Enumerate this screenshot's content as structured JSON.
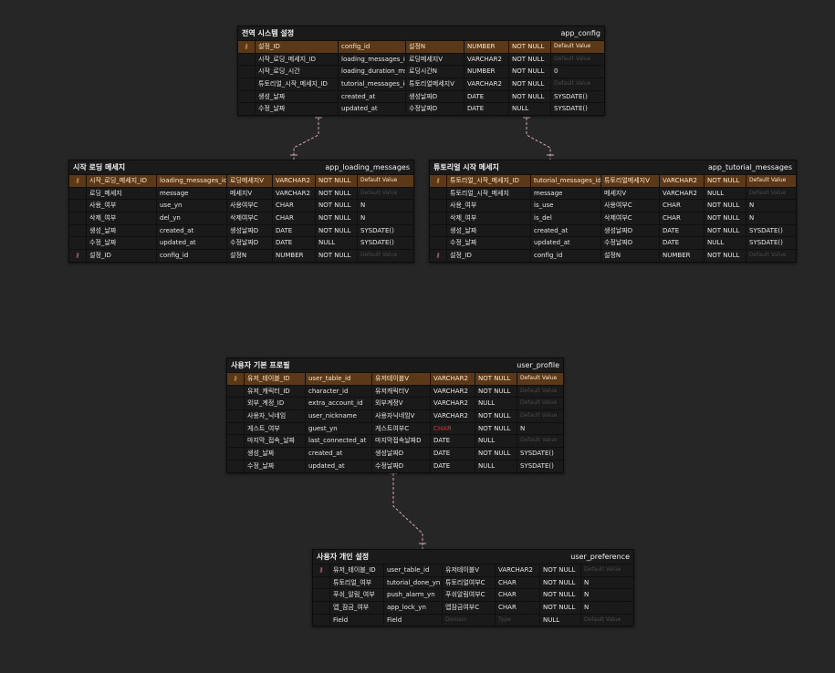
{
  "entities": {
    "app_config": {
      "logical": "전역 시스템 설정",
      "physical": "app_config",
      "rows": [
        {
          "key": "pk",
          "c": [
            "설정_ID",
            "config_id",
            "설정N",
            "NUMBER",
            "NOT NULL",
            "Default Value"
          ],
          "dim": [
            5
          ]
        },
        {
          "key": "",
          "c": [
            "시작_로딩_메세지_ID",
            "loading_messages_id",
            "로딩메세지V",
            "VARCHAR2",
            "NOT NULL",
            "Default Value"
          ],
          "dim": [
            5
          ]
        },
        {
          "key": "",
          "c": [
            "시작_로딩_시간",
            "loading_duration_ms",
            "로딩시간N",
            "NUMBER",
            "NOT NULL",
            "0"
          ],
          "dim": []
        },
        {
          "key": "",
          "c": [
            "튜토리얼_시작_메세지_ID",
            "tutorial_messages_id",
            "튜토리얼메세지V",
            "VARCHAR2",
            "NOT NULL",
            "Default Value"
          ],
          "dim": [
            5
          ]
        },
        {
          "key": "",
          "c": [
            "생성_날짜",
            "created_at",
            "생성날짜D",
            "DATE",
            "NOT NULL",
            "SYSDATE()"
          ],
          "dim": []
        },
        {
          "key": "",
          "c": [
            "수정_날짜",
            "updated_at",
            "수정날짜D",
            "DATE",
            "NULL",
            "SYSDATE()"
          ],
          "dim": []
        }
      ]
    },
    "app_loading_messages": {
      "logical": "시작 로딩 메세지",
      "physical": "app_loading_messages",
      "rows": [
        {
          "key": "pk",
          "c": [
            "시작_로딩_메세지_ID",
            "loading_messages_id",
            "로딩메세지V",
            "VARCHAR2",
            "NOT NULL",
            "Default Value"
          ],
          "dim": [
            5
          ]
        },
        {
          "key": "",
          "c": [
            "로딩_메세지",
            "message",
            "메세지V",
            "VARCHAR2",
            "NOT NULL",
            "Default Value"
          ],
          "dim": [
            5
          ]
        },
        {
          "key": "",
          "c": [
            "사용_여부",
            "use_yn",
            "사용여부C",
            "CHAR",
            "NOT NULL",
            "N"
          ],
          "dim": []
        },
        {
          "key": "",
          "c": [
            "삭제_여부",
            "del_yn",
            "삭제여부C",
            "CHAR",
            "NOT NULL",
            "N"
          ],
          "dim": []
        },
        {
          "key": "",
          "c": [
            "생성_날짜",
            "created_at",
            "생성날짜D",
            "DATE",
            "NOT NULL",
            "SYSDATE()"
          ],
          "dim": []
        },
        {
          "key": "",
          "c": [
            "수정_날짜",
            "updated_at",
            "수정날짜D",
            "DATE",
            "NULL",
            "SYSDATE()"
          ],
          "dim": []
        },
        {
          "key": "fk",
          "c": [
            "설정_ID",
            "config_id",
            "설정N",
            "NUMBER",
            "NOT NULL",
            "Default Value"
          ],
          "dim": [
            5
          ]
        }
      ]
    },
    "app_tutorial_messages": {
      "logical": "튜토리얼 시작 메세지",
      "physical": "app_tutorial_messages",
      "rows": [
        {
          "key": "pk",
          "c": [
            "튜토리얼_시작_메세지_ID",
            "tutorial_messages_id",
            "튜토리얼메세지V",
            "VARCHAR2",
            "NOT NULL",
            "Default Value"
          ],
          "dim": [
            5
          ]
        },
        {
          "key": "",
          "c": [
            "튜토리얼_시작_메세지",
            "message",
            "메세지V",
            "VARCHAR2",
            "NULL",
            "Default Value"
          ],
          "dim": [
            5
          ]
        },
        {
          "key": "",
          "c": [
            "사용_여부",
            "is_use",
            "사용여부C",
            "CHAR",
            "NOT NULL",
            "N"
          ],
          "dim": []
        },
        {
          "key": "",
          "c": [
            "삭제_여부",
            "is_del",
            "삭제여부C",
            "CHAR",
            "NOT NULL",
            "N"
          ],
          "dim": []
        },
        {
          "key": "",
          "c": [
            "생성_날짜",
            "created_at",
            "생성날짜D",
            "DATE",
            "NOT NULL",
            "SYSDATE()"
          ],
          "dim": []
        },
        {
          "key": "",
          "c": [
            "수정_날짜",
            "updated_at",
            "수정날짜D",
            "DATE",
            "NULL",
            "SYSDATE()"
          ],
          "dim": []
        },
        {
          "key": "fk",
          "c": [
            "설정_ID",
            "config_id",
            "설정N",
            "NUMBER",
            "NOT NULL",
            "Default Value"
          ],
          "dim": [
            5
          ]
        }
      ]
    },
    "user_profile": {
      "logical": "사용자 기본 프로필",
      "physical": "user_profile",
      "rows": [
        {
          "key": "pk",
          "c": [
            "유저_테이블_ID",
            "user_table_id",
            "유저테이블V",
            "VARCHAR2",
            "NOT NULL",
            "Default Value"
          ],
          "dim": [
            5
          ]
        },
        {
          "key": "",
          "c": [
            "유저_캐릭터_ID",
            "character_id",
            "유저캐릭터V",
            "VARCHAR2",
            "NOT NULL",
            "Default Value"
          ],
          "dim": [
            5
          ]
        },
        {
          "key": "",
          "c": [
            "외부_계정_ID",
            "extra_account_id",
            "외부계정V",
            "VARCHAR2",
            "NULL",
            "Default Value"
          ],
          "dim": [
            5
          ]
        },
        {
          "key": "",
          "c": [
            "사용자_닉네임",
            "user_nickname",
            "사용자닉네임V",
            "VARCHAR2",
            "NOT NULL",
            "Default Value"
          ],
          "dim": [
            5
          ]
        },
        {
          "key": "",
          "c": [
            "게스트_여부",
            "guest_yn",
            "게스트여부C",
            "CHAR",
            "NOT NULL",
            "N"
          ],
          "dim": [],
          "red": [
            3
          ]
        },
        {
          "key": "",
          "c": [
            "마지막_접속_날짜",
            "last_connected_at",
            "마지막접속날짜D",
            "DATE",
            "NULL",
            "Default Value"
          ],
          "dim": [
            5
          ]
        },
        {
          "key": "",
          "c": [
            "생성_날짜",
            "created_at",
            "생성날짜D",
            "DATE",
            "NOT NULL",
            "SYSDATE()"
          ],
          "dim": []
        },
        {
          "key": "",
          "c": [
            "수정_날짜",
            "updated_at",
            "수정날짜D",
            "DATE",
            "NULL",
            "SYSDATE()"
          ],
          "dim": []
        }
      ]
    },
    "user_preference": {
      "logical": "사용자 개인 설정",
      "physical": "user_preference",
      "rows": [
        {
          "key": "fk",
          "c": [
            "유저_테이블_ID",
            "user_table_id",
            "유저테이블V",
            "VARCHAR2",
            "NOT NULL",
            "Default Value"
          ],
          "dim": [
            5
          ]
        },
        {
          "key": "",
          "c": [
            "튜토리얼_여부",
            "tutorial_done_yn",
            "튜토리얼여부C",
            "CHAR",
            "NOT NULL",
            "N"
          ],
          "dim": []
        },
        {
          "key": "",
          "c": [
            "푸쉬_알림_여부",
            "push_alarm_yn",
            "푸쉬알림여부C",
            "CHAR",
            "NOT NULL",
            "N"
          ],
          "dim": []
        },
        {
          "key": "",
          "c": [
            "앱_잠금_여부",
            "app_lock_yn",
            "앱잠금여부C",
            "CHAR",
            "NOT NULL",
            "N"
          ],
          "dim": []
        },
        {
          "key": "",
          "c": [
            "Field",
            "Field",
            "Domain",
            "Type",
            "NULL",
            "Default Value"
          ],
          "dim": [
            2,
            3,
            5
          ]
        }
      ]
    }
  },
  "colors": {
    "background": "#262626",
    "pk_row": "#5b3918",
    "relation_line": "#d9a7b0",
    "key_icon": "#e8a060"
  },
  "icons": {
    "primary_key": "key-icon",
    "foreign_key": "foreign-key-icon"
  }
}
